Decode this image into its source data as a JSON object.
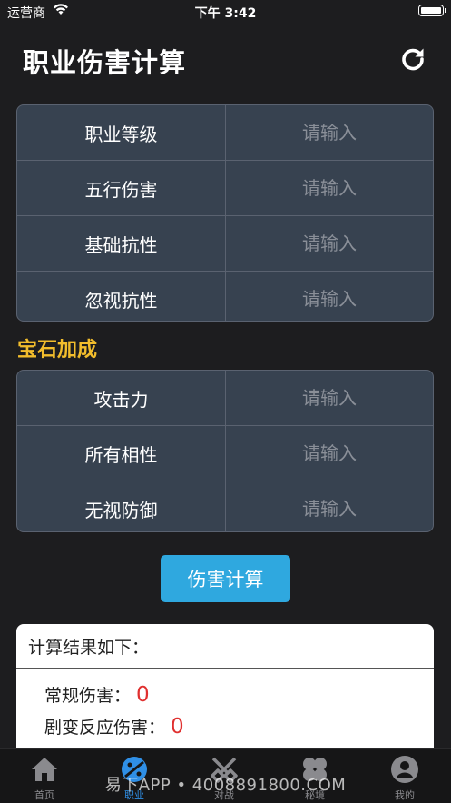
{
  "status_bar": {
    "carrier": "运营商",
    "time": "下午 3:42"
  },
  "header": {
    "title": "职业伤害计算",
    "refresh_icon": "refresh-icon"
  },
  "form_main": [
    {
      "label": "职业等级",
      "placeholder": "请输入",
      "value": ""
    },
    {
      "label": "五行伤害",
      "placeholder": "请输入",
      "value": ""
    },
    {
      "label": "基础抗性",
      "placeholder": "请输入",
      "value": ""
    },
    {
      "label": "忽视抗性",
      "placeholder": "请输入",
      "value": ""
    }
  ],
  "gem_section": {
    "title": "宝石加成",
    "rows": [
      {
        "label": "攻击力",
        "placeholder": "请输入",
        "value": ""
      },
      {
        "label": "所有相性",
        "placeholder": "请输入",
        "value": ""
      },
      {
        "label": "无视防御",
        "placeholder": "请输入",
        "value": ""
      }
    ]
  },
  "calc_button": {
    "label": "伤害计算"
  },
  "result": {
    "heading": "计算结果如下：",
    "normal_label": "常规伤害：",
    "normal_value": "0",
    "mutation_label": "剧变反应伤害：",
    "mutation_value": "0"
  },
  "tabs": [
    {
      "label": "首页",
      "icon": "home-icon",
      "active": false
    },
    {
      "label": "职业",
      "icon": "palette-icon",
      "active": true
    },
    {
      "label": "对战",
      "icon": "crossed-swords-icon",
      "active": false
    },
    {
      "label": "秘境",
      "icon": "grid-icon",
      "active": false
    },
    {
      "label": "我的",
      "icon": "user-icon",
      "active": false
    }
  ],
  "watermark": "易下APP • 4008891800.COM",
  "colors": {
    "accent_blue": "#2fa8df",
    "section_yellow": "#f2bd2c",
    "result_red": "#e0302f",
    "tab_active": "#2f8fe6"
  }
}
